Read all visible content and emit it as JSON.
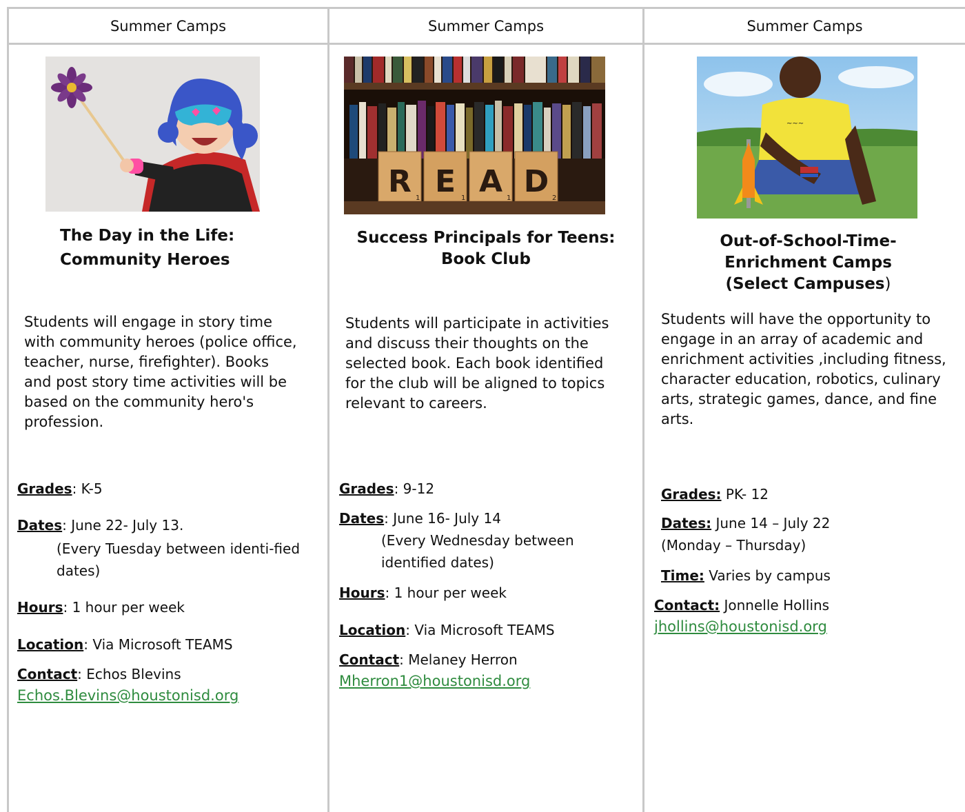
{
  "columns": [
    {
      "header": "Summer Camps",
      "image_icon": "superhero-child-photo",
      "title_line1": "The Day in the Life:",
      "title_line2": "Community Heroes",
      "description": "Students will engage in story time with community heroes (police office, teacher, nurse, firefighter). Books and post story time activities will be based on the community hero's profession.",
      "grades_label": "Grades",
      "grades_value": ": K-5",
      "dates_label": "Dates",
      "dates_value": ": June 22- July 13.",
      "dates_note": "(Every Tuesday between identi-fied dates)",
      "hours_label": "Hours",
      "hours_value": ": 1 hour per week",
      "location_label": "Location",
      "location_value": ": Via Microsoft TEAMS",
      "contact_label": "Contact",
      "contact_value": ": Echos Blevins",
      "email": "Echos.Blevins@houstonisd.org"
    },
    {
      "header": "Summer Camps",
      "image_icon": "bookshelf-read-tiles-photo",
      "read_tiles": [
        "R",
        "E",
        "A",
        "D"
      ],
      "read_tile_scores": [
        "1",
        "1",
        "1",
        "2"
      ],
      "title_line1": "Success Principals for Teens:",
      "title_line2": "Book Club",
      "description": "Students will participate in activities and discuss their thoughts on the selected book. Each book identified for the club will be aligned to topics relevant to careers.",
      "grades_label": "Grades",
      "grades_value": ": 9-12",
      "dates_label": "Dates",
      "dates_value": ": June 16- July 14",
      "dates_note_line1": "(Every Wednesday between",
      "dates_note_line2": "identified dates)",
      "hours_label": "Hours",
      "hours_value": ": 1 hour per week",
      "location_label": "Location",
      "location_value": ": Via Microsoft TEAMS",
      "contact_label": "Contact",
      "contact_value": ": Melaney Herron",
      "email": "Mherron1@houstonisd.org"
    },
    {
      "header": "Summer Camps",
      "image_icon": "student-rocket-photo",
      "title_line1": "Out-of-School-Time-",
      "title_line2": "Enrichment Camps",
      "title_line3": "(Select Campuses",
      "title_line3_paren": ")",
      "description": "Students will have the opportunity to engage in an array of academic and enrichment activities ,including fitness, character education, robotics, culinary arts, strategic games, dance, and fine arts.",
      "grades_label": "Grades:",
      "grades_value": " PK- 12",
      "dates_label": "Dates:",
      "dates_value": " June 14 – July 22",
      "dates_note": "(Monday – Thursday)",
      "time_label": "Time:",
      "time_value": " Varies by campus",
      "contact_label": "Contact:",
      "contact_value": " Jonnelle Hollins",
      "email": "jhollins@houstonisd.org"
    }
  ],
  "colors": {
    "grid": "#c8c8c8",
    "link": "#2e8b3e",
    "text": "#111111"
  }
}
